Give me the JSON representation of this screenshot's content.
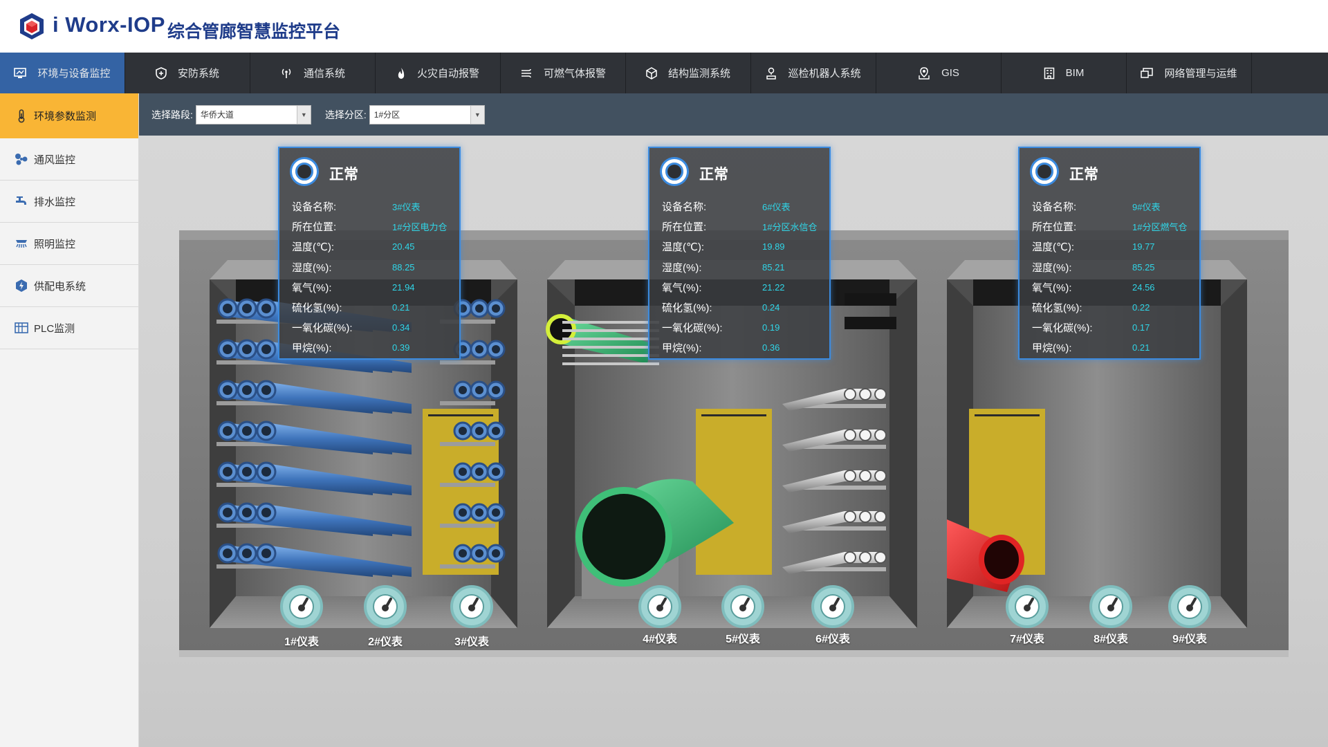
{
  "header": {
    "brand": "i Worx-IOP",
    "subtitle": "综合管廊智慧监控平台"
  },
  "topnav": [
    {
      "label": "环境与设备监控",
      "icon": "monitor-icon",
      "active": true
    },
    {
      "label": "安防系统",
      "icon": "shield-icon",
      "active": false
    },
    {
      "label": "通信系统",
      "icon": "signal-icon",
      "active": false
    },
    {
      "label": "火灾自动报警",
      "icon": "fire-icon",
      "active": false
    },
    {
      "label": "可燃气体报警",
      "icon": "gas-icon",
      "active": false
    },
    {
      "label": "结构监测系统",
      "icon": "cube-icon",
      "active": false
    },
    {
      "label": "巡检机器人系统",
      "icon": "robot-icon",
      "active": false
    },
    {
      "label": "GIS",
      "icon": "map-pin-icon",
      "active": false
    },
    {
      "label": "BIM",
      "icon": "building-icon",
      "active": false
    },
    {
      "label": "网络管理与运维",
      "icon": "network-icon",
      "active": false
    }
  ],
  "sidebar": [
    {
      "label": "环境参数监测",
      "icon": "thermometer-icon",
      "active": true
    },
    {
      "label": "通风监控",
      "icon": "fan-icon",
      "active": false
    },
    {
      "label": "排水监控",
      "icon": "faucet-icon",
      "active": false
    },
    {
      "label": "照明监控",
      "icon": "light-icon",
      "active": false
    },
    {
      "label": "供配电系统",
      "icon": "power-icon",
      "active": false
    },
    {
      "label": "PLC监测",
      "icon": "plc-icon",
      "active": false
    }
  ],
  "filters": {
    "road_label": "选择路段:",
    "road_value": "华侨大道",
    "zone_label": "选择分区:",
    "zone_value": "1#分区"
  },
  "panels": [
    {
      "status": "正常",
      "rows": [
        {
          "k": "设备名称:",
          "v": "3#仪表"
        },
        {
          "k": "所在位置:",
          "v": "1#分区电力仓"
        },
        {
          "k": "温度(℃):",
          "v": "20.45"
        },
        {
          "k": "湿度(%):",
          "v": "88.25"
        },
        {
          "k": "氧气(%):",
          "v": "21.94"
        },
        {
          "k": "硫化氢(%):",
          "v": "0.21"
        },
        {
          "k": "一氧化碳(%):",
          "v": "0.34"
        },
        {
          "k": "甲烷(%):",
          "v": "0.39"
        }
      ]
    },
    {
      "status": "正常",
      "rows": [
        {
          "k": "设备名称:",
          "v": "6#仪表"
        },
        {
          "k": "所在位置:",
          "v": "1#分区水信仓"
        },
        {
          "k": "温度(℃):",
          "v": "19.89"
        },
        {
          "k": "湿度(%):",
          "v": "85.21"
        },
        {
          "k": "氧气(%):",
          "v": "21.22"
        },
        {
          "k": "硫化氢(%):",
          "v": "0.24"
        },
        {
          "k": "一氧化碳(%):",
          "v": "0.19"
        },
        {
          "k": "甲烷(%):",
          "v": "0.36"
        }
      ]
    },
    {
      "status": "正常",
      "rows": [
        {
          "k": "设备名称:",
          "v": "9#仪表"
        },
        {
          "k": "所在位置:",
          "v": "1#分区燃气仓"
        },
        {
          "k": "温度(℃):",
          "v": "19.77"
        },
        {
          "k": "湿度(%):",
          "v": "85.25"
        },
        {
          "k": "氧气(%):",
          "v": "24.56"
        },
        {
          "k": "硫化氢(%):",
          "v": "0.22"
        },
        {
          "k": "一氧化碳(%):",
          "v": "0.17"
        },
        {
          "k": "甲烷(%):",
          "v": "0.21"
        }
      ]
    }
  ],
  "gauges": [
    "1#仪表",
    "2#仪表",
    "3#仪表",
    "4#仪表",
    "5#仪表",
    "6#仪表",
    "7#仪表",
    "8#仪表",
    "9#仪表"
  ],
  "colors": {
    "nav_active": "#3463a4",
    "sidebar_active": "#f9b535",
    "value_cyan": "#2fd6e8",
    "panel_border": "#3b8be0",
    "pipe_blue": "#4a7fc0",
    "pipe_green": "#3fbf78",
    "pipe_red": "#e02424",
    "door_yellow": "#c9ad2a"
  }
}
